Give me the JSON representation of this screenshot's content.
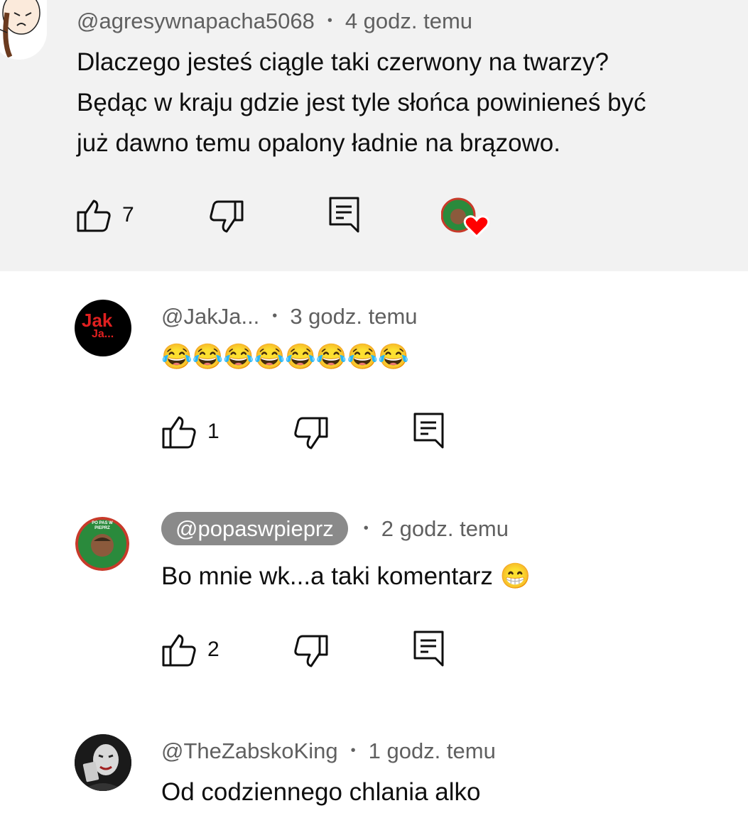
{
  "comments": [
    {
      "author": "@agresywnapacha5068",
      "time": "4 godz. temu",
      "lines": [
        "Dlaczego jesteś ciągle taki czerwony na twarzy?",
        "Będąc w kraju gdzie jest tyle słońca powinieneś być",
        "już dawno temu opalony ładnie na brązowo."
      ],
      "likes": "7",
      "highlighted": true,
      "creator_heart": true
    },
    {
      "author": "@JakJa...",
      "time": "3 godz. temu",
      "text": "😂😂😂😂😂😂😂😂",
      "likes": "1",
      "avatar_text": "Jak",
      "avatar_sub": "Ja..."
    },
    {
      "author": "@popaswpieprz",
      "time": "2 godz. temu",
      "text": "Bo mnie wk...a taki komentarz 😁",
      "likes": "2",
      "author_is_creator": true,
      "avatar_ring_text": "PO PAS W PIEPRZ"
    },
    {
      "author": "@TheZabskoKing",
      "time": "1 godz. temu",
      "text": "Od codziennego chlania alko"
    }
  ],
  "colors": {
    "highlight_bg": "#f2f2f2",
    "meta": "#606060",
    "creator_pill": "#8a8a8a",
    "heart": "#ff0000"
  },
  "icons": {
    "like": "thumb-up-icon",
    "dislike": "thumb-down-icon",
    "reply": "reply-icon",
    "heart": "creator-heart-icon"
  }
}
